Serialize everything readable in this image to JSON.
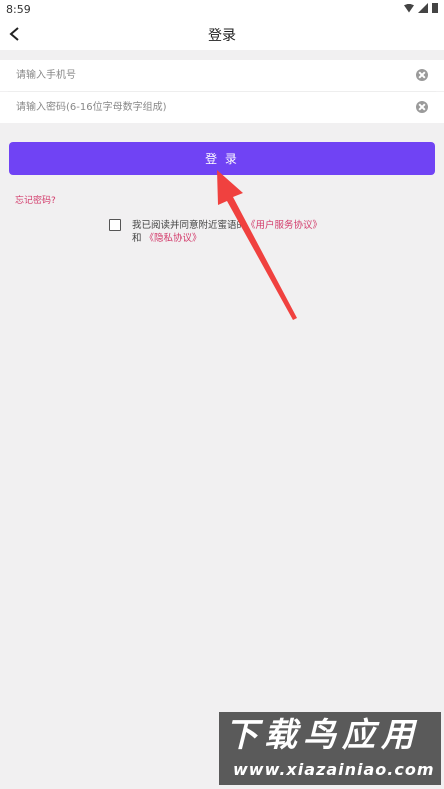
{
  "status_bar": {
    "time": "8:59"
  },
  "header": {
    "title": "登录"
  },
  "form": {
    "phone_placeholder": "请输入手机号",
    "password_placeholder": "请输入密码(6-16位字母数字组成)",
    "login_label": "登 录",
    "forgot_label": "忘记密码?"
  },
  "agreement": {
    "prefix": "我已阅读并同意附近蜜语的",
    "terms_link": "《用户服务协议》",
    "and": "和",
    "privacy_link": "《隐私协议》"
  },
  "watermark": {
    "title": "下载鸟应用",
    "url": "www.xiazainiao.com"
  },
  "colors": {
    "accent": "#7043f4",
    "link": "#d33b6b",
    "arrow": "#f0413f"
  }
}
